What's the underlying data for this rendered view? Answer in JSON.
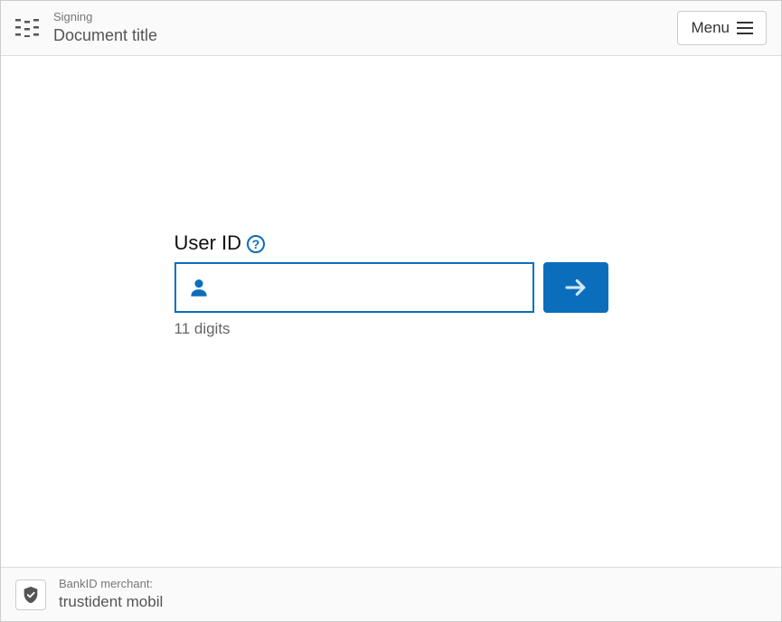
{
  "header": {
    "small": "Signing",
    "title": "Document title",
    "menu_label": "Menu"
  },
  "form": {
    "label": "User ID",
    "hint": "11 digits",
    "value": ""
  },
  "footer": {
    "small": "BankID merchant:",
    "title": "trustident mobil"
  }
}
